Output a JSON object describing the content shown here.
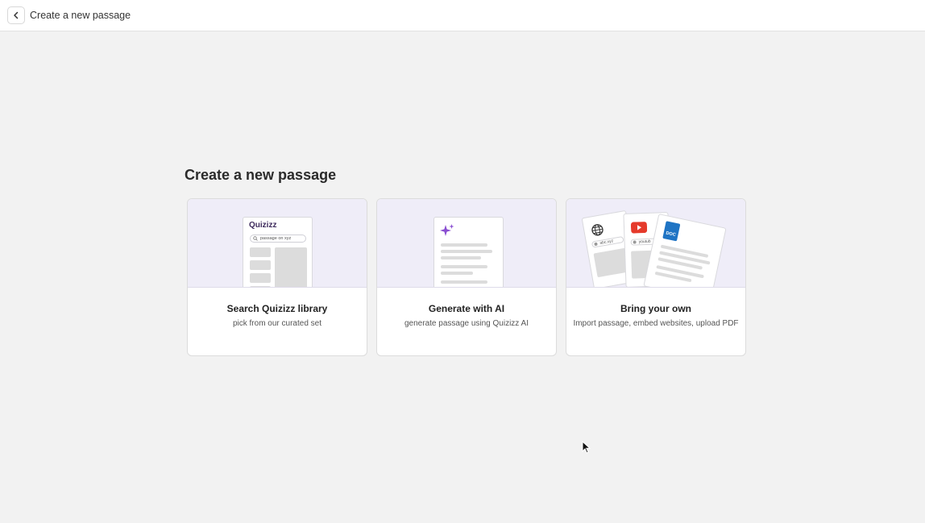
{
  "topbar": {
    "back_icon": "chevron-left-icon",
    "title": "Create a new passage"
  },
  "main": {
    "heading": "Create a new passage"
  },
  "cards": [
    {
      "title": "Search Quizizz library",
      "subtitle": "pick from our curated set",
      "illustration": {
        "logo": "Quizizz",
        "search_text": "passage on xyz"
      }
    },
    {
      "title": "Generate with AI",
      "subtitle": "generate passage using Quizizz AI",
      "illustration": {
        "icon": "sparkle-icon",
        "accent": "#8a4fd1"
      }
    },
    {
      "title": "Bring your own",
      "subtitle": "Import passage, embed websites, upload PDF",
      "illustration": {
        "web_text": "abc.xyz",
        "video_text": "youtub",
        "doc_label": "DOC",
        "youtube_color": "#e53a2b",
        "doc_color": "#1f74c4"
      }
    }
  ]
}
